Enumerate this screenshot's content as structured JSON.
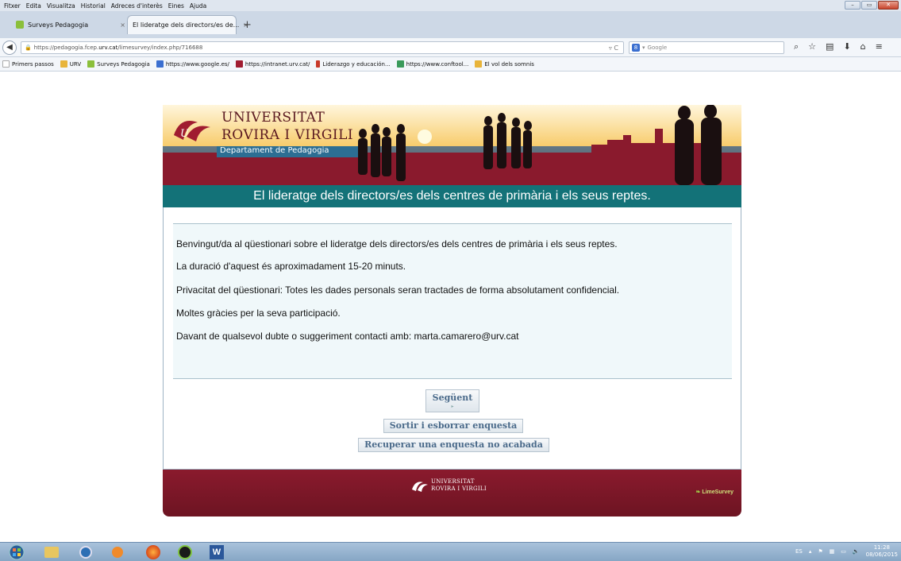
{
  "menubar": {
    "items": [
      "Fitxer",
      "Edita",
      "Visualitza",
      "Historial",
      "Adreces d'interès",
      "Eines",
      "Ajuda"
    ]
  },
  "tabs": [
    {
      "label": "Surveys Pedagogia",
      "close": "×"
    },
    {
      "label": "El lideratge dels directors/es de...",
      "close": "×"
    }
  ],
  "newtab": "+",
  "navbar": {
    "url_prefix": "https://pedagogia.fcep.",
    "url_host": "urv.cat",
    "url_path": "/limesurvey/index.php/716688",
    "search_placeholder": "Google",
    "search_engine_letter": "8"
  },
  "bookmarks": [
    {
      "label": "Primers passos",
      "icon": "page-icon",
      "color": "#ffffff"
    },
    {
      "label": "URV",
      "icon": "folder-icon",
      "color": "#e8b43a"
    },
    {
      "label": "Surveys Pedagogia",
      "icon": "limesurvey-icon",
      "color": "#8bbf3a"
    },
    {
      "label": "https://www.google.es/",
      "icon": "google-icon",
      "color": "#3b6fd0"
    },
    {
      "label": "https://intranet.urv.cat/",
      "icon": "urv-icon",
      "color": "#a01c30"
    },
    {
      "label": "Liderazgo y educación...",
      "icon": "bookmark-icon",
      "color": "#c83a2a"
    },
    {
      "label": "https://www.conftool...",
      "icon": "conftool-icon",
      "color": "#3a9a5a"
    },
    {
      "label": "El vol dels somnis",
      "icon": "folder-icon",
      "color": "#e8b43a"
    }
  ],
  "header": {
    "univ_line1": "UNIVERSITAT",
    "univ_line2": "ROVIRA I VIRGILI",
    "department": "Departament de Pedagogia"
  },
  "survey": {
    "title": "El lideratge dels directors/es dels centres de primària i els seus reptes.",
    "welcome": [
      "Benvingut/da al qüestionari sobre el lideratge dels directors/es dels centres de primària i els seus reptes.",
      "La duració d'aquest és aproximadament 15-20 minuts.",
      "Privacitat del qüestionari: Totes les dades personals seran tractades de forma absolutament confidencial.",
      "Moltes gràcies per la seva participació.",
      "Davant de qualsevol dubte o suggeriment contacti amb: marta.camarero@urv.cat"
    ],
    "next_label": "Següent",
    "exit_label": "Sortir i esborrar enquesta",
    "resume_label": "Recuperar una enquesta no acabada"
  },
  "footer": {
    "univ_line1": "UNIVERSITAT",
    "univ_line2": "ROVIRA I VIRGILI",
    "limesurvey": "LimeSurvey"
  },
  "taskbar": {
    "language": "ES",
    "time": "11:28",
    "date": "08/06/2015",
    "word_letter": "W"
  },
  "colors": {
    "teal": "#137278",
    "maroon": "#8a1a2d",
    "button_text": "#4a6a8a"
  }
}
